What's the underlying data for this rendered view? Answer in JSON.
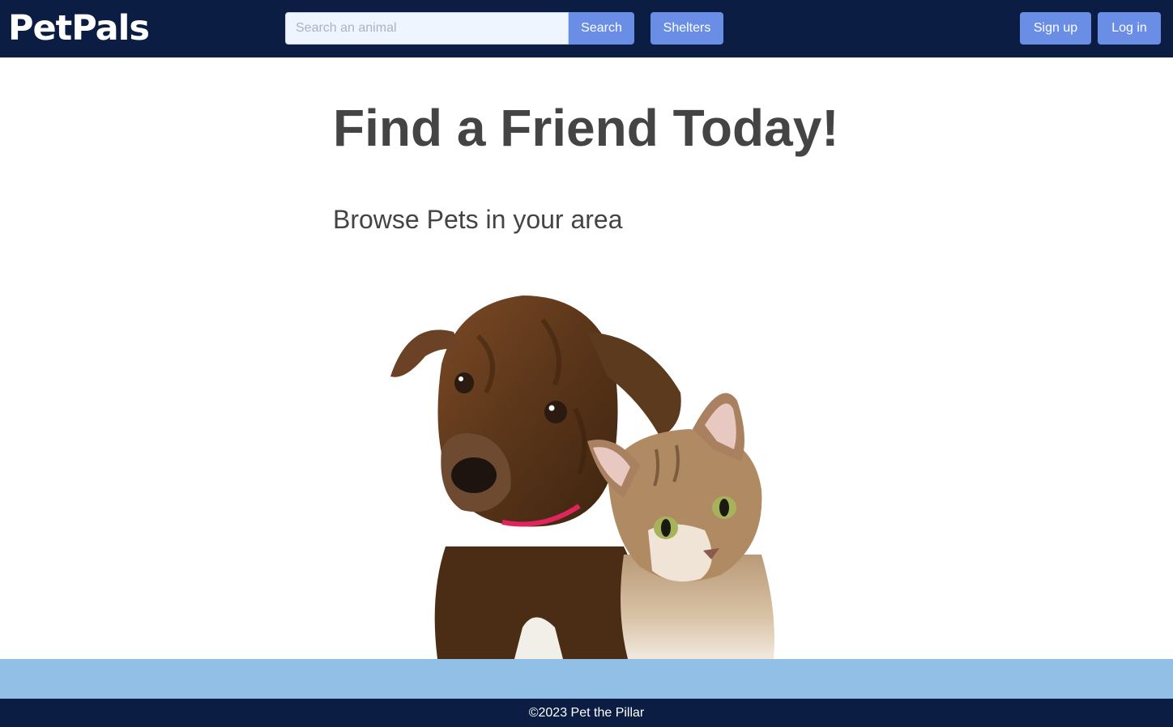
{
  "navbar": {
    "logo": "PetPals",
    "search": {
      "placeholder": "Search an animal",
      "value": "",
      "button_label": "Search"
    },
    "shelters_label": "Shelters",
    "signup_label": "Sign up",
    "login_label": "Log in"
  },
  "hero": {
    "title": "Find a Friend Today!",
    "subtitle": "Browse Pets in your area"
  },
  "footer": {
    "copyright": "©2023 Pet the Pillar"
  },
  "colors": {
    "navbar_bg": "#0b1d42",
    "button_bg": "#6a8ee5",
    "band_bg": "#92bfe6",
    "heading_text": "#444444"
  }
}
